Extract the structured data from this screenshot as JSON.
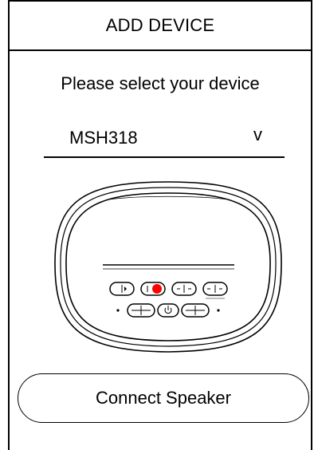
{
  "header": {
    "title": "ADD DEVICE"
  },
  "main": {
    "prompt": "Please select your device",
    "device_select": {
      "value": "MSH318",
      "chevron": "v"
    },
    "device_image": {
      "icon": "speaker-icon",
      "indicator_color": "#ff0000"
    },
    "connect_label": "Connect Speaker"
  }
}
